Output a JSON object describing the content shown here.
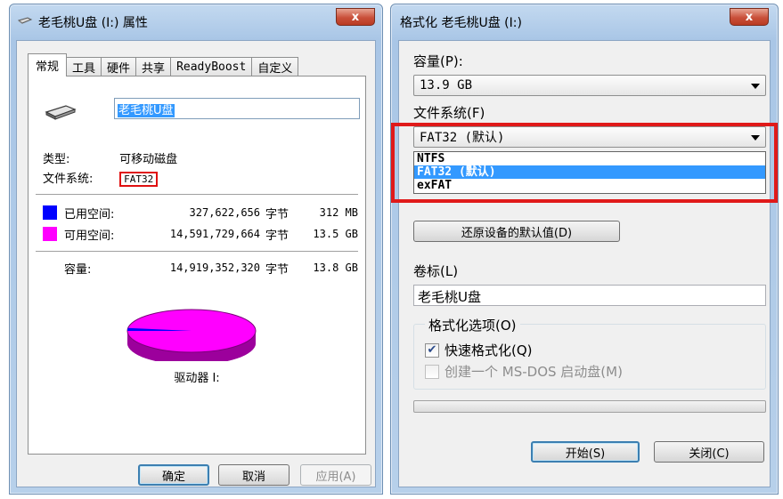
{
  "properties_dialog": {
    "title": "老毛桃U盘 (I:) 属性",
    "close": "x",
    "tabs": [
      "常规",
      "工具",
      "硬件",
      "共享",
      "ReadyBoost",
      "自定义"
    ],
    "volume_name": "老毛桃U盘",
    "type_label": "类型:",
    "type_value": "可移动磁盘",
    "fs_label": "文件系统:",
    "fs_value": "FAT32",
    "used": {
      "label": "已用空间:",
      "bytes": "327,622,656",
      "unit": "字节",
      "size": "312 MB",
      "color": "#0000ff"
    },
    "free": {
      "label": "可用空间:",
      "bytes": "14,591,729,664",
      "unit": "字节",
      "size": "13.5 GB",
      "color": "#ff00ff"
    },
    "capacity": {
      "label": "容量:",
      "bytes": "14,919,352,320",
      "unit": "字节",
      "size": "13.8 GB"
    },
    "used_fraction": 0.022,
    "drive_label": "驱动器 I:",
    "buttons": {
      "ok": "确定",
      "cancel": "取消",
      "apply": "应用(A)"
    }
  },
  "format_dialog": {
    "title": "格式化 老毛桃U盘 (I:)",
    "close": "x",
    "capacity_label": "容量(P):",
    "capacity_value": "13.9 GB",
    "fs_label": "文件系统(F)",
    "fs_value": "FAT32 (默认)",
    "fs_options": [
      "NTFS",
      "FAT32 (默认)",
      "exFAT"
    ],
    "fs_selected_index": 1,
    "restore_button": "还原设备的默认值(D)",
    "volume_label": "卷标(L)",
    "volume_value": "老毛桃U盘",
    "options_title": "格式化选项(O)",
    "quick_format": {
      "label": "快速格式化(Q)",
      "checked": true,
      "check_mark": "✔"
    },
    "msdos": {
      "label": "创建一个 MS-DOS 启动盘(M)",
      "checked": false
    },
    "buttons": {
      "start": "开始(S)",
      "close": "关闭(C)"
    }
  }
}
